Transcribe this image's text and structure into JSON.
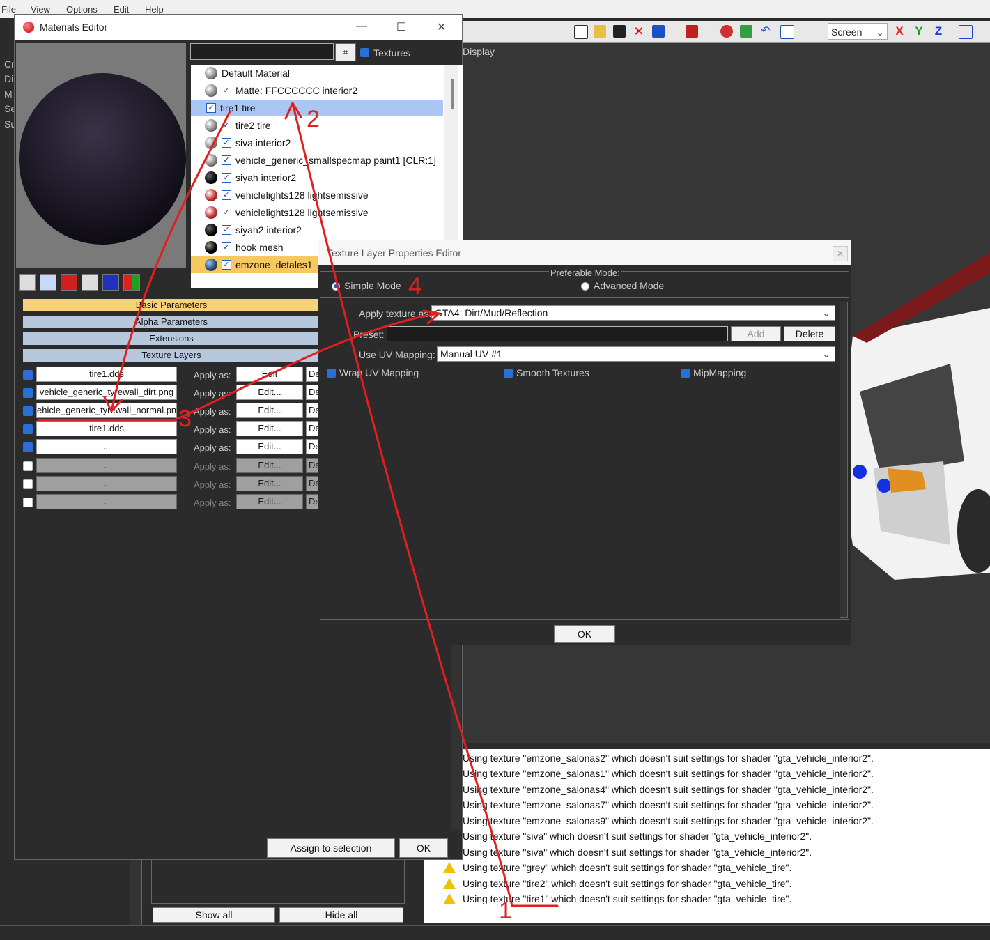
{
  "menu": {
    "file": "File",
    "view": "View",
    "options": "Options",
    "edit": "Edit",
    "help": "Help"
  },
  "toolbar": {
    "space_combo": "Screen",
    "axis_x": "X",
    "axis_y": "Y",
    "axis_z": "Z"
  },
  "viewport": {
    "label": "Display"
  },
  "left_strip": [
    "Cr",
    "Di",
    "M",
    "Se",
    "Su"
  ],
  "materials_editor": {
    "title": "Materials Editor",
    "textures_label": "Textures",
    "materials": [
      {
        "name": "Default Material",
        "checked": false
      },
      {
        "name": "Matte: FFCCCCCC interior2",
        "checked": true
      },
      {
        "name": "tire1 tire",
        "checked": true,
        "selected": true
      },
      {
        "name": "tire2 tire",
        "checked": true
      },
      {
        "name": "siva interior2",
        "checked": true
      },
      {
        "name": "vehicle_generic_smallspecmap paint1 [CLR:1]",
        "checked": true
      },
      {
        "name": "siyah interior2",
        "checked": true
      },
      {
        "name": "vehiclelights128 lightsemissive",
        "checked": true
      },
      {
        "name": "vehiclelights128 lightsemissive",
        "checked": true
      },
      {
        "name": "siyah2 interior2",
        "checked": true
      },
      {
        "name": "hook mesh",
        "checked": true
      },
      {
        "name": "emzone_detales1",
        "checked": true
      }
    ],
    "rollouts": {
      "basic": "Basic Parameters",
      "alpha": "Alpha Parameters",
      "extensions": "Extensions",
      "texture_layers": "Texture Layers"
    },
    "texture_layers": [
      {
        "name": "tire1.dds",
        "enabled": true,
        "apply": "Apply as:",
        "edit": "Edit",
        "de": "De"
      },
      {
        "name": "vehicle_generic_tyrewall_dirt.png",
        "enabled": true,
        "apply": "Apply as:",
        "edit": "Edit...",
        "de": "De"
      },
      {
        "name": "ehicle_generic_tyrewall_normal.pn",
        "enabled": true,
        "apply": "Apply as:",
        "edit": "Edit...",
        "de": "De"
      },
      {
        "name": "tire1.dds",
        "enabled": true,
        "apply": "Apply as:",
        "edit": "Edit...",
        "de": "De"
      },
      {
        "name": "...",
        "enabled": true,
        "apply": "Apply as:",
        "edit": "Edit...",
        "de": "De"
      },
      {
        "name": "...",
        "enabled": false,
        "apply": "Apply as:",
        "edit": "Edit...",
        "de": "De"
      },
      {
        "name": "...",
        "enabled": false,
        "apply": "Apply as:",
        "edit": "Edit...",
        "de": "De"
      },
      {
        "name": "...",
        "enabled": false,
        "apply": "Apply as:",
        "edit": "Edit...",
        "de": "De"
      }
    ],
    "assign_button": "Assign to selection",
    "ok_button": "OK"
  },
  "texture_layer_editor": {
    "title": "Texture Layer Properties Editor",
    "preferable_mode_label": "Preferable Mode:",
    "simple_mode": "Simple Mode",
    "advanced_mode": "Advanced Mode",
    "apply_texture_label": "Apply texture as:",
    "apply_texture_value": "GTA4: Dirt/Mud/Reflection",
    "preset_label": "Preset:",
    "preset_value": "",
    "add_button": "Add",
    "delete_button": "Delete",
    "uv_label": "Use UV Mapping:",
    "uv_value": "Manual UV #1",
    "wrap_uv": "Wrap UV Mapping",
    "smooth_textures": "Smooth Textures",
    "mipmapping": "MipMapping",
    "ok_button": "OK"
  },
  "lower_panel": {
    "show_all": "Show all",
    "hide_all": "Hide all"
  },
  "log": [
    {
      "text": "Using texture \"emzone_salonas2\" which doesn't suit settings for shader \"gta_vehicle_interior2\".",
      "warning": false
    },
    {
      "text": "Using texture \"emzone_salonas1\" which doesn't suit settings for shader \"gta_vehicle_interior2\".",
      "warning": false
    },
    {
      "text": "Using texture \"emzone_salonas4\" which doesn't suit settings for shader \"gta_vehicle_interior2\".",
      "warning": false
    },
    {
      "text": "Using texture \"emzone_salonas7\" which doesn't suit settings for shader \"gta_vehicle_interior2\".",
      "warning": false
    },
    {
      "text": "Using texture \"emzone_salonas9\" which doesn't suit settings for shader \"gta_vehicle_interior2\".",
      "warning": false
    },
    {
      "text": "Using texture \"siva\" which doesn't suit settings for shader \"gta_vehicle_interior2\".",
      "warning": false
    },
    {
      "text": "Using texture \"siva\" which doesn't suit settings for shader \"gta_vehicle_interior2\".",
      "warning": false
    },
    {
      "text": "Using texture \"grey\" which doesn't suit settings for shader \"gta_vehicle_tire\".",
      "warning": true
    },
    {
      "text": "Using texture \"tire2\" which doesn't suit settings for shader \"gta_vehicle_tire\".",
      "warning": true
    },
    {
      "text": "Using texture \"tire1\" which doesn't suit settings for shader \"gta_vehicle_tire\".",
      "warning": true
    }
  ],
  "annotations": {
    "n1": "1",
    "n2": "2",
    "n3": "3",
    "n4": "4"
  },
  "colors": {
    "annotation": "#e02020",
    "selection": "#aac6f4",
    "accent": "#2a6fd6",
    "rollout_basic": "#f8d27a",
    "rollout": "#b8c8dc"
  }
}
